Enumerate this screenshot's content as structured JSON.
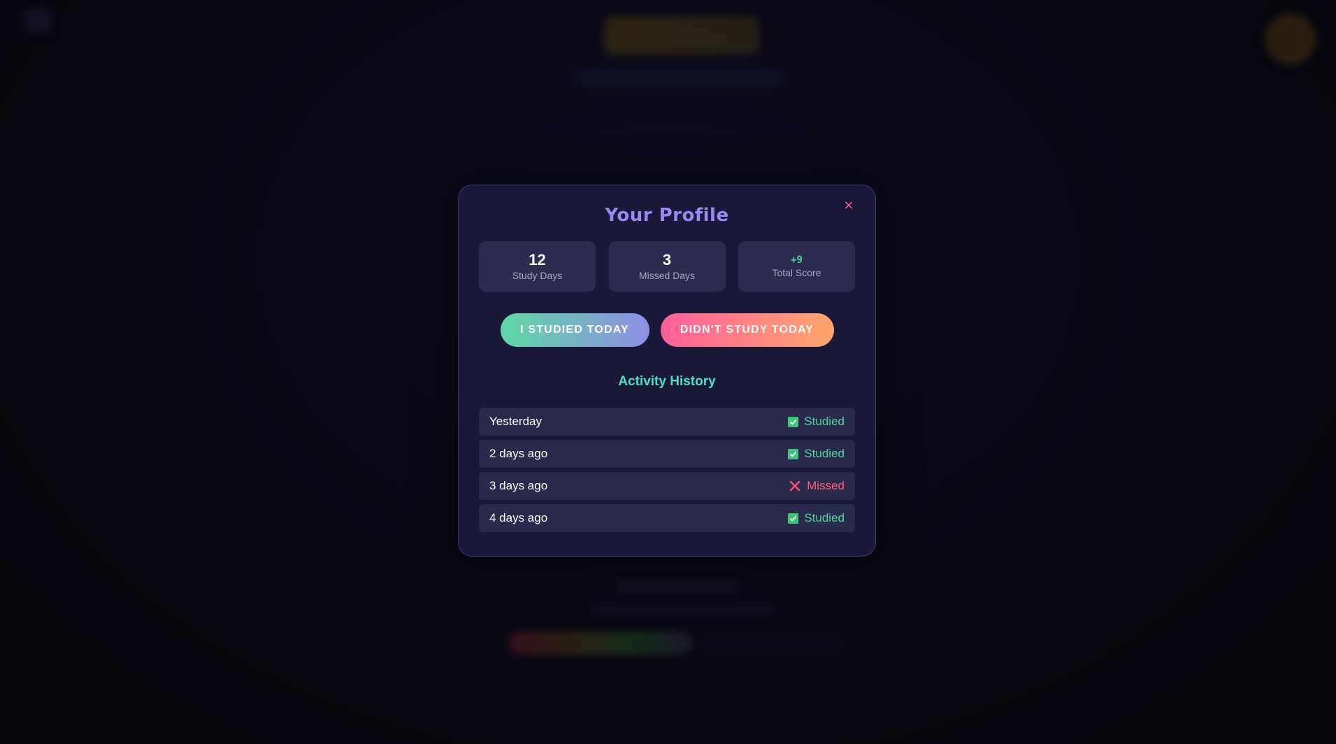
{
  "modal": {
    "title": "Your Profile",
    "close_glyph": "×",
    "stats": [
      {
        "value": "12",
        "label": "Study Days"
      },
      {
        "value": "3",
        "label": "Missed Days"
      },
      {
        "value": "+9",
        "label": "Total Score"
      }
    ],
    "actions": {
      "studied_label": "I STUDIED TODAY",
      "missed_label": "DIDN'T STUDY TODAY"
    },
    "history_title": "Activity History",
    "history": [
      {
        "day": "Yesterday",
        "status": "Studied",
        "icon": "check-icon"
      },
      {
        "day": "2 days ago",
        "status": "Studied",
        "icon": "check-icon"
      },
      {
        "day": "3 days ago",
        "status": "Missed",
        "icon": "cross-icon"
      },
      {
        "day": "4 days ago",
        "status": "Studied",
        "icon": "check-icon"
      }
    ]
  },
  "colors": {
    "title": "#9b87f5",
    "studied": "#4fd69c",
    "missed": "#ff5c7a",
    "history_title": "#4fe0c3",
    "close": "#ff5c8a"
  }
}
